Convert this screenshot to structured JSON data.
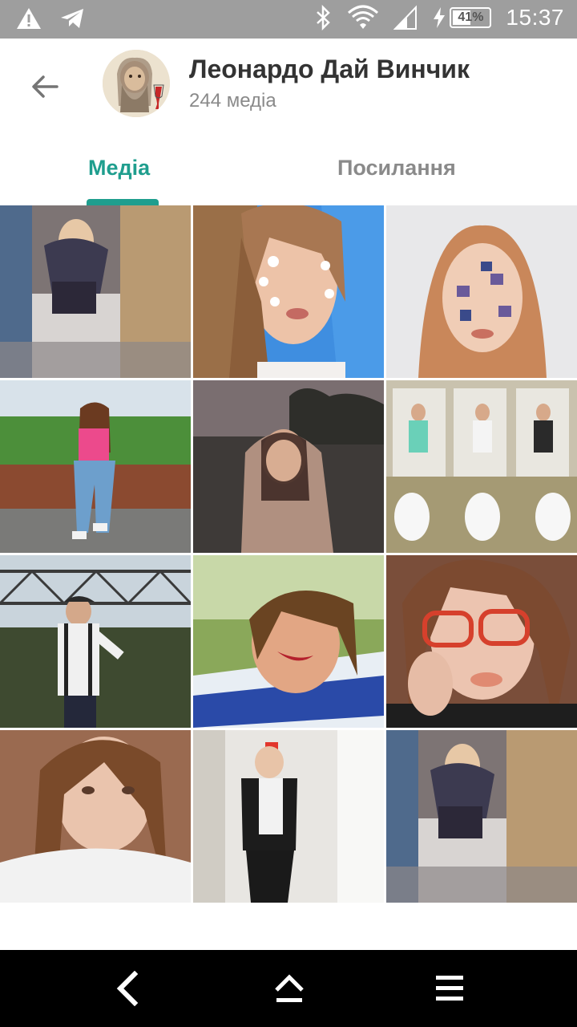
{
  "status_bar": {
    "battery_percent": "41%",
    "time": "15:37",
    "icons": [
      "warning-icon",
      "telegram-icon",
      "bluetooth-icon",
      "wifi-icon",
      "signal-icon",
      "charging-icon",
      "battery-icon"
    ]
  },
  "header": {
    "title": "Леонардо Дай Винчик",
    "subtitle": "244 медіа",
    "back_icon": "back-arrow-icon"
  },
  "tabs": [
    {
      "label": "Медіа",
      "active": true
    },
    {
      "label": "Посилання",
      "active": false
    }
  ],
  "colors": {
    "accent": "#1f9e8e",
    "status_bar": "#9e9e9e",
    "nav_bar": "#000000",
    "inactive_tab": "#8a8a8a"
  },
  "media_grid": {
    "count": 12
  },
  "nav_bar": {
    "icons": [
      "nav-back-icon",
      "nav-home-icon",
      "nav-menu-icon"
    ]
  }
}
